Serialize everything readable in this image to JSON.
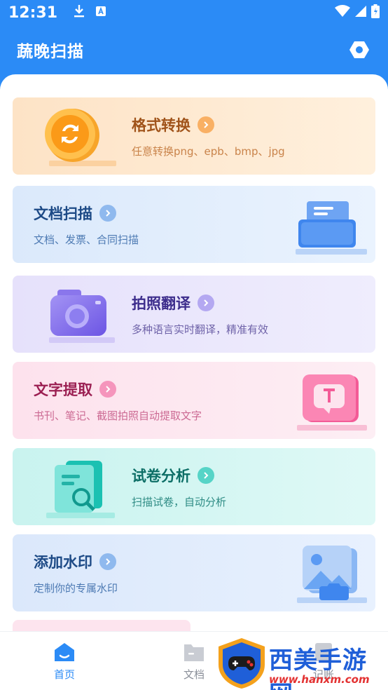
{
  "status_bar": {
    "time": "12:31"
  },
  "header": {
    "title": "蔬晚扫描"
  },
  "cards": [
    {
      "title": "格式转换",
      "subtitle": "任意转换png、epb、bmp、jpg"
    },
    {
      "title": "文档扫描",
      "subtitle": "文档、发票、合同扫描"
    },
    {
      "title": "拍照翻译",
      "subtitle": "多种语言实时翻译，精准有效"
    },
    {
      "title": "文字提取",
      "subtitle": "书刊、笔记、截图拍照自动提取文字"
    },
    {
      "title": "试卷分析",
      "subtitle": "扫描试卷，自动分析"
    },
    {
      "title": "添加水印",
      "subtitle": "定制你的专属水印"
    }
  ],
  "tabbar": {
    "tabs": [
      {
        "label": "首页",
        "active": true
      },
      {
        "label": "文档",
        "active": false
      },
      {
        "label": "记账",
        "active": false
      }
    ]
  },
  "watermark": {
    "text": "西美手游网",
    "url": "www.hanxm.com"
  },
  "colors": {
    "primary": "#2b8bf6",
    "convert_bg": "#fde8cf",
    "scan_bg": "#dceafb",
    "translate_bg": "#e8e4fb",
    "extract_bg": "#fde4ee",
    "analysis_bg": "#d4f5f2",
    "watermark_bg": "#dfeafb"
  },
  "icons": [
    "download-icon",
    "keyboard-a-icon",
    "wifi-icon",
    "signal-icon",
    "battery-icon",
    "settings-hex-icon",
    "home-icon",
    "folder-icon",
    "ledger-icon"
  ]
}
